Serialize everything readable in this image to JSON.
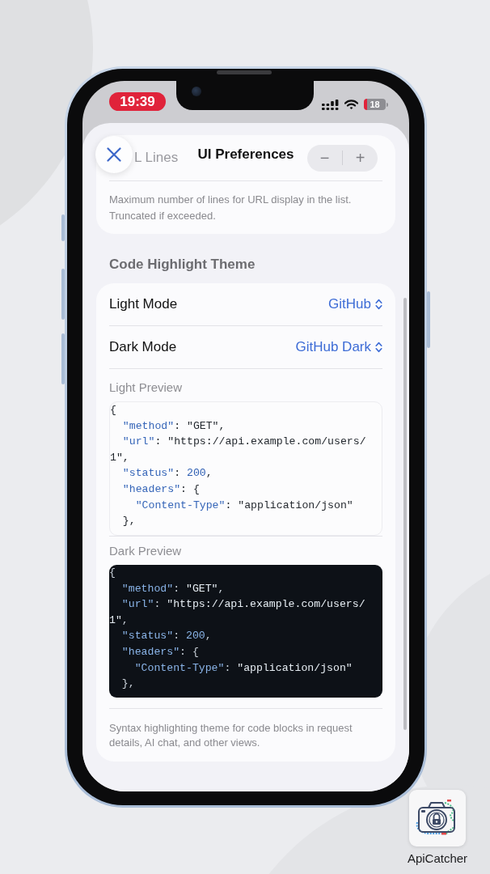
{
  "status_bar": {
    "time": "19:39",
    "recording": true,
    "battery": "18"
  },
  "sheet": {
    "title": "UI Preferences"
  },
  "url_lines_card": {
    "row_label": "L Lines",
    "stepper": {
      "decrement": "−",
      "increment": "+"
    },
    "footnote": "Maximum number of lines for URL display in the list. Truncated if exceeded."
  },
  "code_highlight_theme": {
    "header": "Code Highlight Theme",
    "pickers": [
      {
        "label": "Light Mode",
        "value": "GitHub"
      },
      {
        "label": "Dark Mode",
        "value": "GitHub Dark"
      }
    ],
    "previews": [
      {
        "label": "Light Preview",
        "kind": "light",
        "lines": [
          [
            {
              "kind": "punct",
              "text": "{"
            }
          ],
          [
            {
              "kind": "key",
              "text": "  \"method\""
            },
            {
              "kind": "punct",
              "text": ": "
            },
            {
              "kind": "string",
              "text": "\"GET\""
            },
            {
              "kind": "punct",
              "text": ","
            }
          ],
          [
            {
              "kind": "key",
              "text": "  \"url\""
            },
            {
              "kind": "punct",
              "text": ": "
            },
            {
              "kind": "string",
              "text": "\"https://api.example.com/users/"
            }
          ],
          [
            {
              "kind": "string",
              "text": "1\""
            },
            {
              "kind": "punct",
              "text": ","
            }
          ],
          [
            {
              "kind": "key",
              "text": "  \"status\""
            },
            {
              "kind": "punct",
              "text": ": "
            },
            {
              "kind": "number",
              "text": "200"
            },
            {
              "kind": "punct",
              "text": ","
            }
          ],
          [
            {
              "kind": "key",
              "text": "  \"headers\""
            },
            {
              "kind": "punct",
              "text": ": {"
            }
          ],
          [
            {
              "kind": "key",
              "text": "    \"Content-Type\""
            },
            {
              "kind": "punct",
              "text": ": "
            },
            {
              "kind": "string",
              "text": "\"application/json\""
            }
          ],
          [
            {
              "kind": "punct",
              "text": "  },"
            }
          ]
        ]
      },
      {
        "label": "Dark Preview",
        "kind": "dark",
        "lines": [
          [
            {
              "kind": "punct",
              "text": "{"
            }
          ],
          [
            {
              "kind": "key",
              "text": "  \"method\""
            },
            {
              "kind": "punct",
              "text": ": "
            },
            {
              "kind": "string",
              "text": "\"GET\""
            },
            {
              "kind": "punct",
              "text": ","
            }
          ],
          [
            {
              "kind": "key",
              "text": "  \"url\""
            },
            {
              "kind": "punct",
              "text": ": "
            },
            {
              "kind": "string",
              "text": "\"https://api.example.com/users/"
            }
          ],
          [
            {
              "kind": "string",
              "text": "1\""
            },
            {
              "kind": "punct",
              "text": ","
            }
          ],
          [
            {
              "kind": "key",
              "text": "  \"status\""
            },
            {
              "kind": "punct",
              "text": ": "
            },
            {
              "kind": "number",
              "text": "200"
            },
            {
              "kind": "punct",
              "text": ","
            }
          ],
          [
            {
              "kind": "key",
              "text": "  \"headers\""
            },
            {
              "kind": "punct",
              "text": ": {"
            }
          ],
          [
            {
              "kind": "key",
              "text": "    \"Content-Type\""
            },
            {
              "kind": "punct",
              "text": ": "
            },
            {
              "kind": "string",
              "text": "\"application/json\""
            }
          ],
          [
            {
              "kind": "punct",
              "text": "  },"
            }
          ]
        ]
      }
    ],
    "footnote": "Syntax highlighting theme for code blocks in request details, AI chat, and other views."
  },
  "app_badge": {
    "name": "ApiCatcher"
  }
}
